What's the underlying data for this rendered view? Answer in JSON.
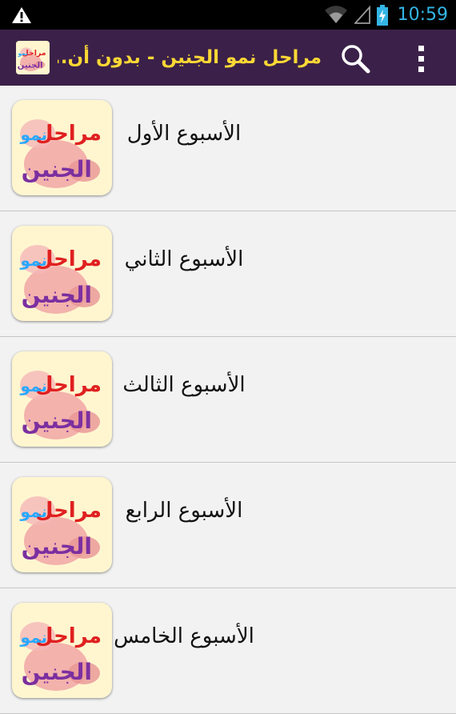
{
  "status_bar": {
    "time": "10:59",
    "icons": [
      "warning-icon",
      "wifi-icon",
      "signal-icon",
      "battery-charging-icon"
    ]
  },
  "action_bar": {
    "title": "مراحل نمو الجنين - بدون أن..",
    "search_icon": "search-icon",
    "menu_icon": "overflow-menu-icon"
  },
  "logo_text": {
    "line1_a": "مراحل",
    "line1_b": "نمو",
    "line2": "الجنين"
  },
  "items": [
    {
      "label": "الأسبوع الأول"
    },
    {
      "label": "الأسبوع الثاني"
    },
    {
      "label": "الأسبوع الثالث"
    },
    {
      "label": "الأسبوع الرابع"
    },
    {
      "label": "الأسبوع الخامس"
    }
  ],
  "colors": {
    "action_bar": "#3b2149",
    "title": "#fdd835",
    "status_accent": "#33b5e5",
    "background": "#f2f2f2"
  }
}
